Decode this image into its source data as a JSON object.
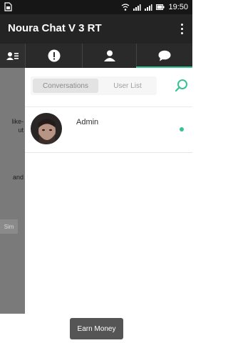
{
  "status_bar": {
    "time": "19:50",
    "icons": [
      "wifi-icon",
      "signal-1-icon",
      "signal-2-icon",
      "battery-icon"
    ]
  },
  "app_bar": {
    "title": "Noura Chat V 3 RT",
    "menu_icon": "more-vert-icon"
  },
  "tabs": [
    {
      "icon": "contacts-card-icon",
      "active": false
    },
    {
      "icon": "alert-icon",
      "active": false
    },
    {
      "icon": "person-icon",
      "active": false
    },
    {
      "icon": "chat-bubble-icon",
      "active": true
    }
  ],
  "drawer": {
    "lines": [
      "like-",
      "ut",
      "and"
    ],
    "button_label": "Sim"
  },
  "segmented": {
    "conversations": "Conversations",
    "user_list": "User List",
    "selected": "Conversations"
  },
  "conversation": {
    "name": "Admin",
    "online": true
  },
  "earn_button": {
    "label": "Earn Money"
  },
  "colors": {
    "accent": "#37c295",
    "app_bar": "#242424",
    "tab_bar": "#2a2a2a"
  }
}
